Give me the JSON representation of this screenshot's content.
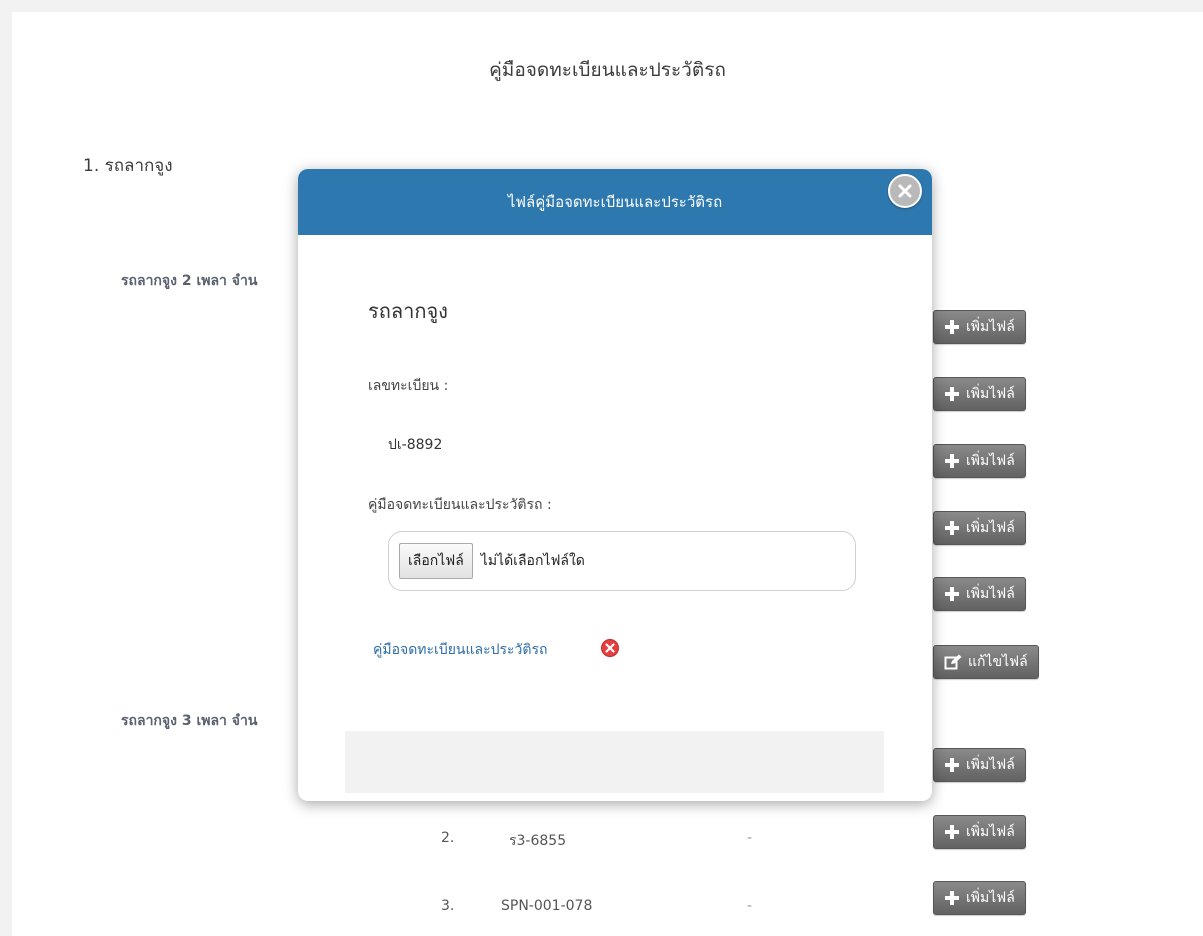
{
  "page": {
    "title": "คู่มือจดทะเบียนและประวัติรถ",
    "section_title": "1. รถลากจูง",
    "groups": [
      {
        "label": "รถลากจูง 2 เพลา จำน"
      },
      {
        "label": "รถลากจูง 3 เพลา จำน"
      }
    ],
    "buttons": {
      "add_file": "เพิ่มไฟล์",
      "edit_file": "แก้ไขไฟล์"
    },
    "rows": [
      {
        "no": "2.",
        "plate": "ร3-6855",
        "file": "-"
      },
      {
        "no": "3.",
        "plate": "SPN-001-078",
        "file": "-"
      }
    ]
  },
  "modal": {
    "header": "ไฟล์คู่มือจดทะเบียนและประวัติรถ",
    "title": "รถลากจูง",
    "plate_label": "เลขทะเบียน :",
    "plate_value": "ปเ-8892",
    "file_label": "คู่มือจดทะเบียนและประวัติรถ :",
    "choose_file": "เลือกไฟล์",
    "no_file": "ไม่ได้เลือกไฟล์ใด",
    "file_link": "คู่มือจดทะเบียนและประวัติรถ"
  },
  "colors": {
    "modal_header": "#2e78b0",
    "button_gray": "#6f6f6f",
    "delete_red": "#e53e3e",
    "link_blue": "#2e6da4"
  },
  "icons": {
    "add": "plus-icon",
    "edit": "edit-icon",
    "close": "close-circle-icon",
    "delete": "delete-circle-icon"
  }
}
